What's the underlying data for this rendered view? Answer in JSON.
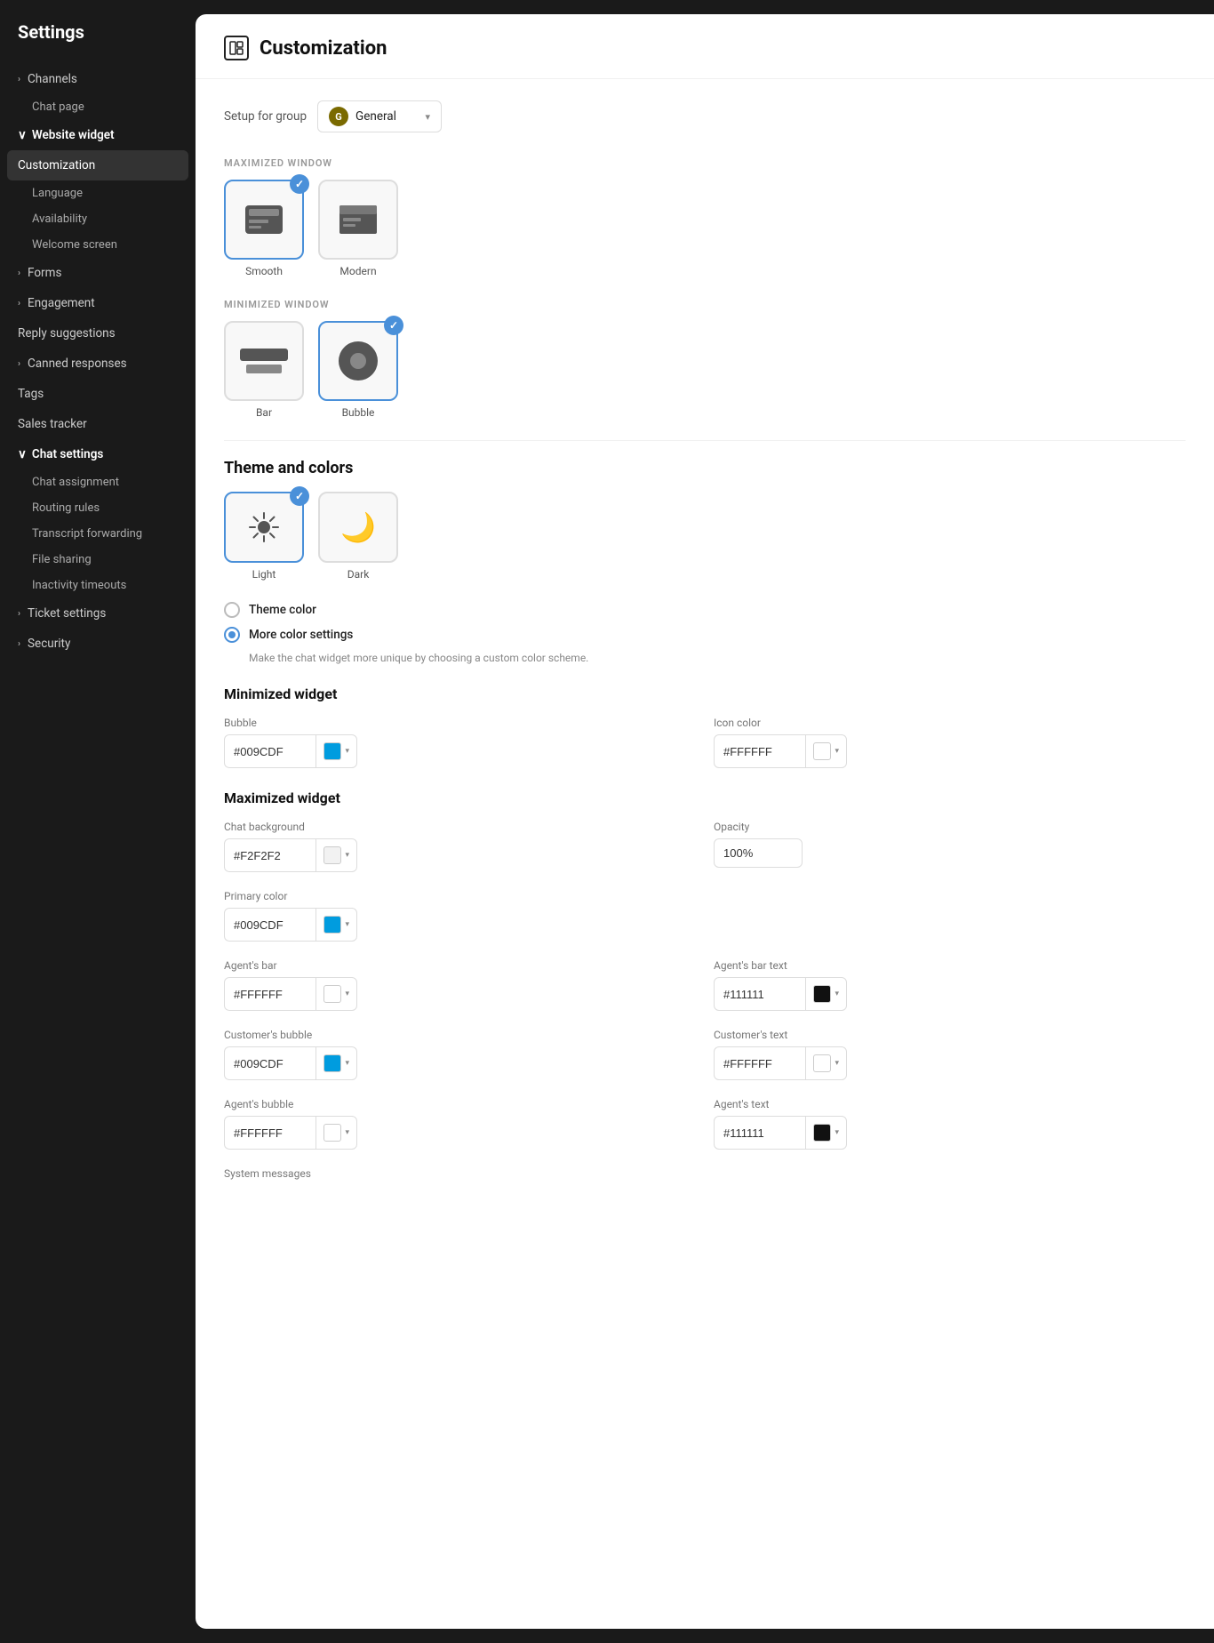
{
  "sidebar": {
    "title": "Settings",
    "items": [
      {
        "id": "channels",
        "label": "Channels",
        "type": "expandable",
        "expanded": false
      },
      {
        "id": "chat-page",
        "label": "Chat page",
        "type": "sub"
      },
      {
        "id": "website-widget",
        "label": "Website widget",
        "type": "expandable",
        "expanded": true
      },
      {
        "id": "customization",
        "label": "Customization",
        "type": "sub-active"
      },
      {
        "id": "language",
        "label": "Language",
        "type": "sub-child"
      },
      {
        "id": "availability",
        "label": "Availability",
        "type": "sub-child"
      },
      {
        "id": "welcome-screen",
        "label": "Welcome screen",
        "type": "sub-child"
      },
      {
        "id": "forms",
        "label": "Forms",
        "type": "expandable"
      },
      {
        "id": "engagement",
        "label": "Engagement",
        "type": "expandable"
      },
      {
        "id": "reply-suggestions",
        "label": "Reply suggestions",
        "type": "plain"
      },
      {
        "id": "canned-responses",
        "label": "Canned responses",
        "type": "expandable"
      },
      {
        "id": "tags",
        "label": "Tags",
        "type": "plain"
      },
      {
        "id": "sales-tracker",
        "label": "Sales tracker",
        "type": "plain"
      },
      {
        "id": "chat-settings",
        "label": "Chat settings",
        "type": "expandable",
        "expanded": true
      },
      {
        "id": "chat-assignment",
        "label": "Chat assignment",
        "type": "sub-child"
      },
      {
        "id": "routing-rules",
        "label": "Routing rules",
        "type": "sub-child"
      },
      {
        "id": "transcript-forwarding",
        "label": "Transcript forwarding",
        "type": "sub-child"
      },
      {
        "id": "file-sharing",
        "label": "File sharing",
        "type": "sub-child"
      },
      {
        "id": "inactivity-timeouts",
        "label": "Inactivity timeouts",
        "type": "sub-child"
      },
      {
        "id": "ticket-settings",
        "label": "Ticket settings",
        "type": "expandable"
      },
      {
        "id": "security",
        "label": "Security",
        "type": "expandable"
      }
    ]
  },
  "header": {
    "title": "Customization",
    "icon": "layout-icon"
  },
  "setup": {
    "label": "Setup for group",
    "group_name": "General",
    "group_initial": "G"
  },
  "maximized_window": {
    "section_label": "MAXIMIZED WINDOW",
    "options": [
      {
        "id": "smooth",
        "label": "Smooth",
        "selected": true
      },
      {
        "id": "modern",
        "label": "Modern",
        "selected": false
      }
    ]
  },
  "minimized_window": {
    "section_label": "MINIMIZED WINDOW",
    "options": [
      {
        "id": "bar",
        "label": "Bar",
        "selected": false
      },
      {
        "id": "bubble",
        "label": "Bubble",
        "selected": true
      }
    ]
  },
  "theme": {
    "title": "Theme and colors",
    "options": [
      {
        "id": "light",
        "label": "Light",
        "selected": true
      },
      {
        "id": "dark",
        "label": "Dark",
        "selected": false
      }
    ]
  },
  "color_settings": {
    "theme_color_label": "Theme color",
    "more_color_label": "More color settings",
    "more_color_sub": "Make the chat widget more unique by choosing a custom color scheme."
  },
  "minimized_widget": {
    "title": "Minimized widget",
    "bubble_label": "Bubble",
    "bubble_color": "#009CDF",
    "bubble_swatch": "#009CDF",
    "icon_color_label": "Icon color",
    "icon_color": "#FFFFFF",
    "icon_swatch": "#FFFFFF"
  },
  "maximized_widget": {
    "title": "Maximized widget",
    "chat_background_label": "Chat background",
    "chat_background_color": "#F2F2F2",
    "chat_background_swatch": "#F2F2F2",
    "opacity_label": "Opacity",
    "opacity_value": "100%",
    "primary_color_label": "Primary color",
    "primary_color": "#009CDF",
    "primary_swatch": "#009CDF",
    "agents_bar_label": "Agent's bar",
    "agents_bar_color": "#FFFFFF",
    "agents_bar_swatch": "#FFFFFF",
    "agents_bar_text_label": "Agent's bar text",
    "agents_bar_text_color": "#111111",
    "agents_bar_text_swatch": "#111111",
    "customers_bubble_label": "Customer's bubble",
    "customers_bubble_color": "#009CDF",
    "customers_bubble_swatch": "#009CDF",
    "customers_text_label": "Customer's text",
    "customers_text_color": "#FFFFFF",
    "customers_text_swatch": "#FFFFFF",
    "agents_bubble_label": "Agent's bubble",
    "agents_bubble_color": "#FFFFFF",
    "agents_bubble_swatch": "#FFFFFF",
    "agents_text_label": "Agent's text",
    "agents_text_color": "#111111",
    "agents_text_swatch": "#111111",
    "system_messages_label": "System messages"
  }
}
